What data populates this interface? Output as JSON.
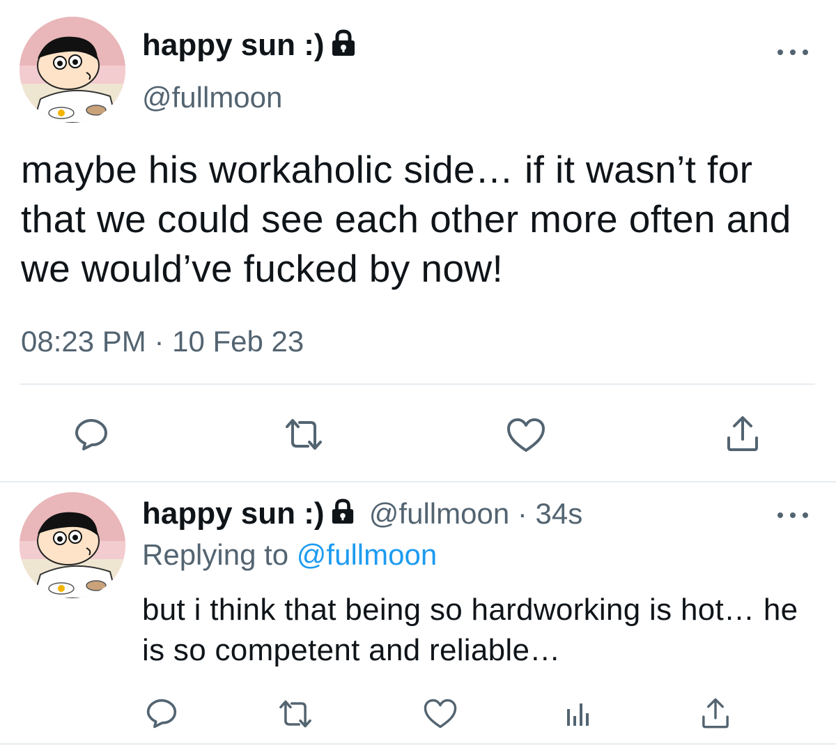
{
  "main_tweet": {
    "display_name": "happy sun :)",
    "handle": "@fullmoon",
    "text": "maybe his workaholic side… if it wasn’t for that we could see each other more often and we would’ve fucked by now!",
    "timestamp": "08:23 PM · 10 Feb 23",
    "avatar_icon": "cartoon-boy-avatar",
    "lock_icon": "lock-icon",
    "actions": [
      "reply-icon",
      "retweet-icon",
      "like-icon",
      "share-icon"
    ]
  },
  "reply_tweet": {
    "display_name": "happy sun :)",
    "meta": "@fullmoon · 34s",
    "replying_prefix": "Replying to",
    "replying_mention": "@fullmoon",
    "text": "but i think that being so hardworking is hot… he is so competent and reliable…",
    "actions": [
      "reply-icon",
      "retweet-icon",
      "like-icon",
      "analytics-icon",
      "share-icon"
    ]
  },
  "colors": {
    "text": "#0f1419",
    "secondary": "#536471",
    "link": "#1d9bf0",
    "divider": "#e6ecf0"
  }
}
